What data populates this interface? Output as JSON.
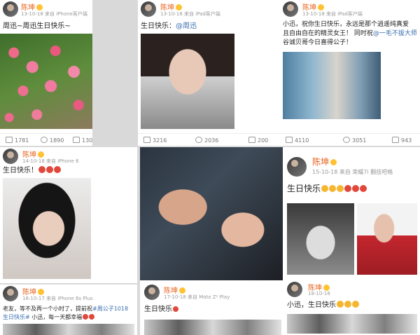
{
  "posts": [
    {
      "name": "陈坤",
      "meta": "13-10-18 来自 iPhone客户端",
      "text": "周迅~周迅生日快乐~",
      "actions": {
        "share": "1781",
        "comment": "1890",
        "like": "130"
      }
    },
    {
      "name": "陈坤",
      "meta": "13-10-18 来自 iPad客户端",
      "text_prefix": "生日快乐：",
      "text_link": "@周迅",
      "actions": {
        "share": "3216",
        "comment": "2036",
        "like": "200"
      }
    },
    {
      "name": "陈坤",
      "meta": "13-10-18 来自 iPad客户端",
      "line1": "小迅，祝你生日快乐，永远是那个逍遥纯真爱",
      "line2": "且自由自在的精灵女王！ 同时祝",
      "line2_link": "@一毛不拔大师",
      "line3": "谷诚贝哥今日喜得公子！",
      "actions": {
        "share": "4110",
        "comment": "3051",
        "like": "943"
      }
    },
    {
      "name": "陈坤",
      "meta": "14-10-18 来自 iPhone 6",
      "text": "生日快乐！"
    },
    {
      "name": "陈坤",
      "meta": "17-10-18 来自 Moto Z² Play",
      "text": "生日快乐"
    },
    {
      "name": "陈坤",
      "meta": "15-10-18 来自 荣耀7i 翻技吧格",
      "text": "生日快乐"
    },
    {
      "name": "陈坤",
      "meta": "16-10-17 来自 iPhone 6s Plus",
      "line1_prefix": "老友，等不及再一个小时了，提前祝",
      "line1_link": "#周公子1018",
      "line2_link": "生日快乐#",
      "line2_suffix": " 小迅，每一天都幸福"
    },
    {
      "name": "陈坤",
      "meta": "18-10-18",
      "text": "小迅，生日快乐"
    }
  ]
}
